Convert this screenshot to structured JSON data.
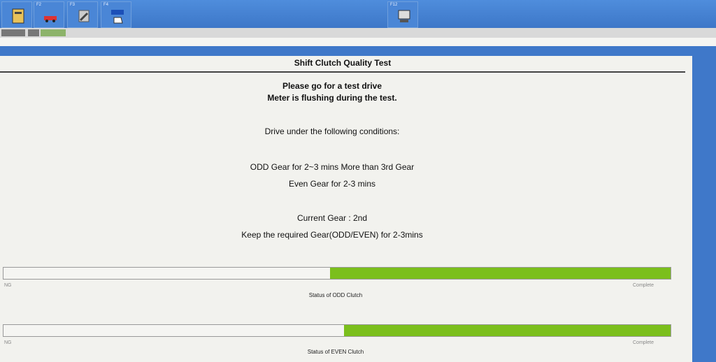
{
  "toolbar": {
    "buttons": [
      {
        "key": "",
        "icon": "notebook-icon"
      },
      {
        "key": "F2",
        "icon": "red-car-icon"
      },
      {
        "key": "F3",
        "icon": "wrench-hand-icon"
      },
      {
        "key": "F4",
        "icon": "test-hand-icon"
      },
      {
        "key": "F12",
        "icon": "screen-capture-icon"
      }
    ]
  },
  "panel": {
    "title": "Shift Clutch Quality Test",
    "lines": [
      "Please go for a test drive",
      "Meter is flushing during the test.",
      "Drive under the following conditions:",
      "ODD Gear for 2~3 mins More than 3rd Gear",
      "Even Gear for 2-3 mins",
      "Current Gear : 2nd",
      "Keep the required Gear(ODD/EVEN) for 2-3mins"
    ]
  },
  "bars": [
    {
      "progress": 0.51,
      "left_label": "NG",
      "right_label": "Complete",
      "caption": "Status of ODD Clutch"
    },
    {
      "progress": 0.49,
      "left_label": "NG",
      "right_label": "Complete",
      "caption": "Status of EVEN Clutch"
    }
  ],
  "colors": {
    "fill": "#7bbf1c",
    "toolbar": "#3f78c9"
  }
}
